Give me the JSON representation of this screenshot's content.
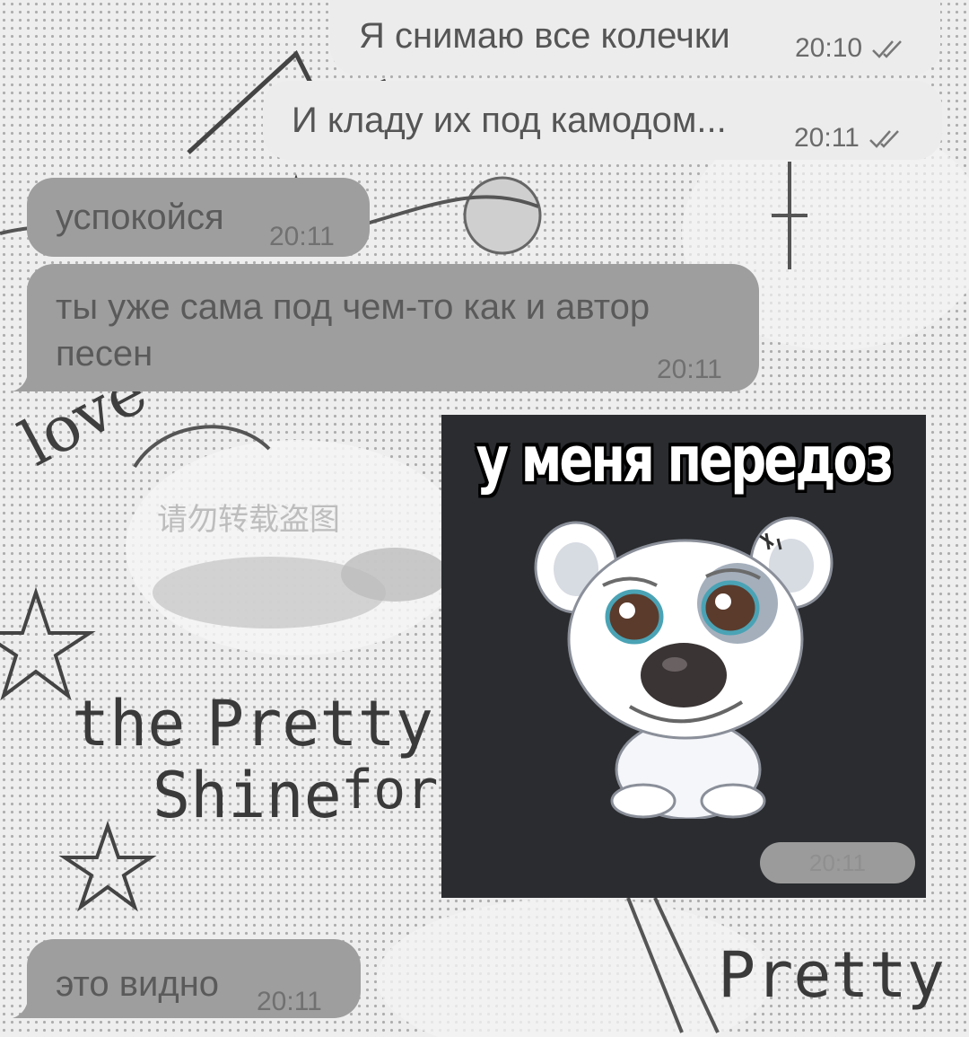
{
  "messages": [
    {
      "id": "m1",
      "direction": "outgoing",
      "text": "Я снимаю все колечки",
      "time": "20:10",
      "read": true
    },
    {
      "id": "m2",
      "direction": "outgoing",
      "text": "И кладу их под камодом...",
      "time": "20:11",
      "read": true
    },
    {
      "id": "m3",
      "direction": "incoming",
      "text": "успокойся",
      "time": "20:11"
    },
    {
      "id": "m4",
      "direction": "incoming",
      "text_line1": "ты уже сама под чем-то как и автор",
      "text_line2": "песен",
      "time": "20:11"
    },
    {
      "id": "m5",
      "direction": "outgoing",
      "type": "sticker",
      "caption": "у меня передоз",
      "time": "20:11",
      "read": true
    },
    {
      "id": "m6",
      "direction": "incoming",
      "text": "это видно",
      "time": "20:11"
    }
  ],
  "wallpaper": {
    "texts": [
      "love",
      "the",
      "Pretty",
      "Shine",
      "for",
      "Pretty St",
      "请勿转载盗图"
    ]
  },
  "colors": {
    "outgoing_bubble": "#ececec",
    "incoming_bubble": "#9e9e9e",
    "sticker_bg": "#2a2c2f",
    "text": "#555555"
  }
}
